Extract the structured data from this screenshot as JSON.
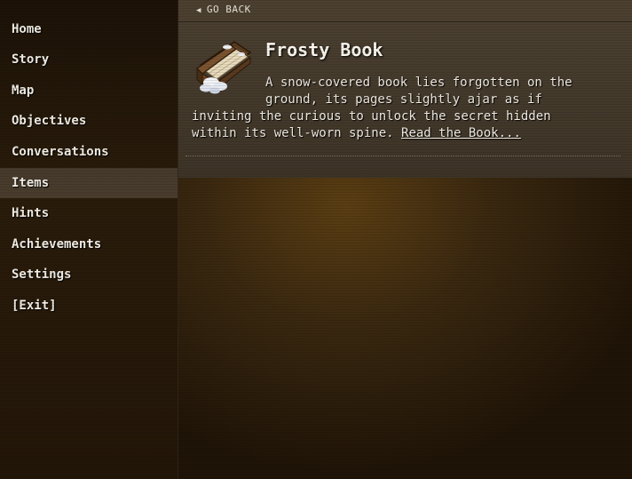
{
  "menu": {
    "items": [
      {
        "label": "Home"
      },
      {
        "label": "Story"
      },
      {
        "label": "Map"
      },
      {
        "label": "Objectives"
      },
      {
        "label": "Conversations"
      },
      {
        "label": "Items"
      },
      {
        "label": "Hints"
      },
      {
        "label": "Achievements"
      },
      {
        "label": "Settings"
      },
      {
        "label": "[Exit]"
      }
    ],
    "active": "Items"
  },
  "topbar": {
    "back_label": "GO BACK",
    "back_icon": "triangle-left-icon"
  },
  "item": {
    "title": "Frosty Book",
    "icon": "frosty-book-icon",
    "description": "A snow-covered book lies forgotten on the ground, its pages slightly ajar as if inviting the curious to unlock the secret hidden within its well-worn spine.",
    "link_label": "Read the Book..."
  }
}
